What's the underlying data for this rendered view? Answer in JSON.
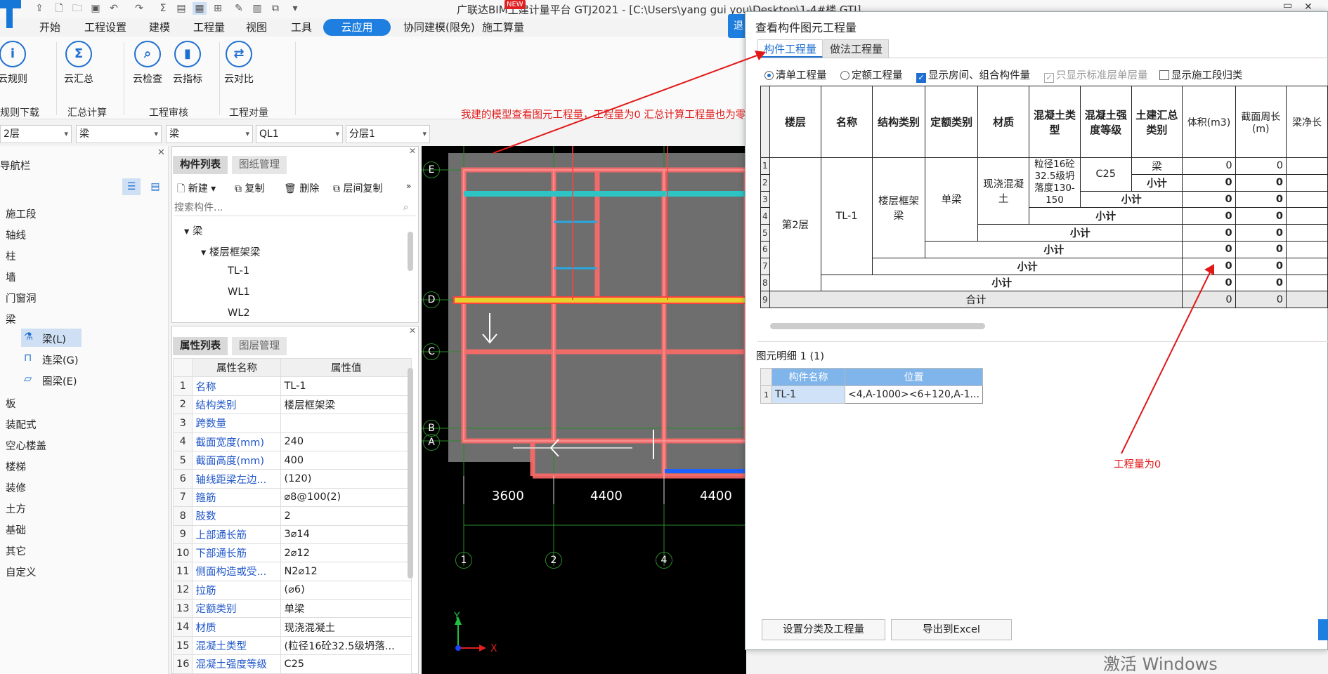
{
  "app": {
    "title": "广联达BIM土建计量平台 GTJ2021 - [C:\\Users\\yang gui you\\Desktop\\1-4#楼.GTJ]",
    "new_badge": "NEW"
  },
  "menu": [
    "开始",
    "工程设置",
    "建模",
    "工程量",
    "视图",
    "工具",
    "云应用",
    "协同建模(限免)",
    "施工算量"
  ],
  "ribbon": {
    "buttons": [
      "云规则",
      "云汇总",
      "云检查",
      "云指标",
      "云对比"
    ],
    "groups": [
      "规则下载",
      "汇总计算",
      "工程审核",
      "工程对量"
    ]
  },
  "selectors": [
    "2层",
    "梁",
    "梁",
    "QL1",
    "分层1"
  ],
  "annotation": {
    "top": "我建的模型查看图元工程量，工程量为0    汇总计算工程量也为零",
    "bottom": "工程量为0",
    "color": "#e01818"
  },
  "nav": {
    "title": "导航栏",
    "items": [
      "施工段",
      "轴线",
      "柱",
      "墙",
      "门窗洞",
      "梁",
      "梁(L)",
      "连梁(G)",
      "圈梁(E)",
      "板",
      "装配式",
      "空心楼盖",
      "楼梯",
      "装修",
      "土方",
      "基础",
      "其它",
      "自定义"
    ]
  },
  "component_panel": {
    "tabs": [
      "构件列表",
      "图纸管理"
    ],
    "toolbar": [
      "新建",
      "复制",
      "删除",
      "层间复制"
    ],
    "search_placeholder": "搜索构件...",
    "tree": [
      "梁",
      "楼层框架梁",
      "TL-1",
      "WL1",
      "WL2"
    ]
  },
  "property_panel": {
    "tabs": [
      "属性列表",
      "图层管理"
    ],
    "headers": [
      "属性名称",
      "属性值"
    ],
    "rows": [
      {
        "n": "1",
        "k": "名称",
        "v": "TL-1"
      },
      {
        "n": "2",
        "k": "结构类别",
        "v": "楼层框架梁"
      },
      {
        "n": "3",
        "k": "跨数量",
        "v": ""
      },
      {
        "n": "4",
        "k": "截面宽度(mm)",
        "v": "240"
      },
      {
        "n": "5",
        "k": "截面高度(mm)",
        "v": "400"
      },
      {
        "n": "6",
        "k": "轴线距梁左边...",
        "v": "(120)"
      },
      {
        "n": "7",
        "k": "箍筋",
        "v": "⌀8@100(2)"
      },
      {
        "n": "8",
        "k": "肢数",
        "v": "2"
      },
      {
        "n": "9",
        "k": "上部通长筋",
        "v": "3⌀14"
      },
      {
        "n": "10",
        "k": "下部通长筋",
        "v": "2⌀12"
      },
      {
        "n": "11",
        "k": "侧面构造或受...",
        "v": "N2⌀12"
      },
      {
        "n": "12",
        "k": "拉筋",
        "v": "(⌀6)"
      },
      {
        "n": "13",
        "k": "定额类别",
        "v": "单梁"
      },
      {
        "n": "14",
        "k": "材质",
        "v": "现浇混凝土"
      },
      {
        "n": "15",
        "k": "混凝土类型",
        "v": "(粒径16砼32.5级坍落..."
      },
      {
        "n": "16",
        "k": "混凝土强度等级",
        "v": "C25"
      }
    ]
  },
  "cad": {
    "axis_labels_h": [
      "E",
      "D",
      "C",
      "B",
      "A"
    ],
    "axis_labels_v": [
      "1",
      "2",
      "4"
    ],
    "dims": [
      "3600",
      "4400",
      "4400"
    ],
    "x_label": "X",
    "y_label": "Y"
  },
  "dialog": {
    "title": "查看构件图元工程量",
    "tabs": [
      "构件工程量",
      "做法工程量"
    ],
    "options": [
      "清单工程量",
      "定额工程量",
      "显示房间、组合构件量",
      "只显示标准层单层量",
      "显示施工段归类"
    ],
    "table_headers": [
      "楼层",
      "名称",
      "结构类别",
      "定额类别",
      "材质",
      "混凝土类型",
      "混凝土强度等级",
      "土建汇总类别",
      "体积(m3)",
      "截面周长(m)",
      "梁净长"
    ],
    "floor": "第2层",
    "name": "TL-1",
    "struct": "楼层框架梁",
    "quota": "单梁",
    "material": "现浇混凝土",
    "concrete_type": "粒径16砼32.5级坍落度130-150",
    "grade": "C25",
    "summary_cat": "梁",
    "subtotal": "小计",
    "total": "合计",
    "zero": "0",
    "row_numbers": [
      "1",
      "2",
      "3",
      "4",
      "5",
      "6",
      "7",
      "8",
      "9"
    ],
    "detail_label": "图元明细",
    "detail_count": "1 (1)",
    "detail_headers": [
      "构件名称",
      "位置"
    ],
    "detail_row": {
      "name": "TL-1",
      "pos": "<4,A-1000><6+120,A-1..."
    },
    "buttons": [
      "设置分类及工程量",
      "导出到Excel"
    ],
    "side_button": "退"
  },
  "watermark": "激活 Windows"
}
